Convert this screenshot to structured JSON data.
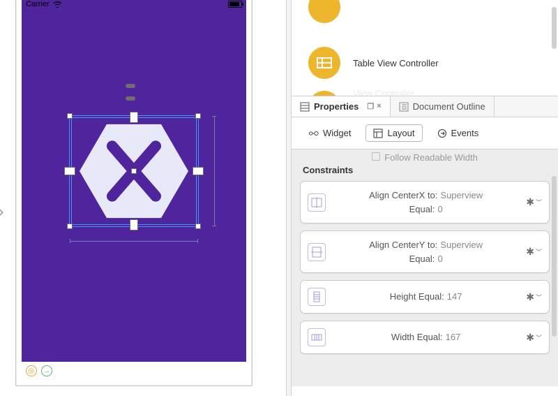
{
  "canvas": {
    "status_carrier": "Carrier",
    "dock_icons": [
      "entrypoint-icon",
      "exitpoint-icon"
    ]
  },
  "library": {
    "items": [
      {
        "label": ""
      },
      {
        "label": "Table View Controller"
      },
      {
        "label": "View Controller"
      }
    ]
  },
  "tabs": {
    "properties": "Properties",
    "outline": "Document Outline"
  },
  "subtabs": {
    "widget": "Widget",
    "layout": "Layout",
    "events": "Events"
  },
  "follow_label": "Follow Readable Width",
  "constraints": {
    "header": "Constraints",
    "cards": [
      {
        "line1_k": "Align CenterX to:",
        "line1_v": "Superview",
        "line2_k": "Equal:",
        "line2_v": "0",
        "icon": "centerx"
      },
      {
        "line1_k": "Align CenterY to:",
        "line1_v": "Superview",
        "line2_k": "Equal:",
        "line2_v": "0",
        "icon": "centery"
      },
      {
        "line1_k": "Height Equal:",
        "line1_v": "147",
        "line2_k": "",
        "line2_v": "",
        "icon": "height"
      },
      {
        "line1_k": "Width Equal:",
        "line1_v": "167",
        "line2_k": "",
        "line2_v": "",
        "icon": "width"
      }
    ]
  }
}
